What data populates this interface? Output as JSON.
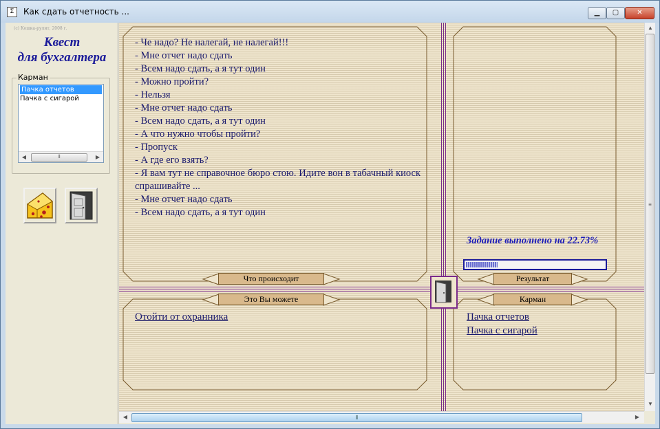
{
  "window": {
    "title": "Как сдать отчетность ...",
    "title_icon": "document-icon",
    "buttons": {
      "minimize": "▁",
      "maximize": "▢",
      "close": "✕"
    }
  },
  "left_panel": {
    "copyright": "(c) Кошка-рулит, 2008 г.",
    "title_line1": "Квест",
    "title_line2": "для бухгалтера",
    "pocket_label": "Карман",
    "pocket_items": [
      "Пачка отчетов",
      "Пачка с сигарой"
    ],
    "selected_item": "Пачка отчетов",
    "tools": [
      {
        "name": "cheese-icon"
      },
      {
        "name": "door-icon"
      }
    ]
  },
  "dialog": {
    "lines": [
      "- Че надо? Не налегай, не налегай!!!",
      "- Мне отчет надо сдать",
      "- Всем надо сдать, а я тут один",
      "- Можно пройти?",
      "- Нельзя",
      "- Мне отчет надо сдать",
      "- Всем надо сдать, а я тут один",
      "- А что нужно чтобы пройти?",
      "- Пропуск",
      "- А где его взять?",
      "- Я вам тут не справочное бюро стою. Идите вон в табачный киоск спрашивайте ...",
      "- Мне отчет надо сдать",
      "- Всем надо сдать, а я тут один"
    ]
  },
  "tags": {
    "what_happens": "Что происходит",
    "result": "Результат",
    "you_can": "Это Вы можете",
    "pocket": "Карман"
  },
  "actions": [
    "Отойти от охранника"
  ],
  "pocket_links": [
    "Пачка отчетов",
    "Пачка с сигарой"
  ],
  "progress": {
    "label": "Задание выполнено на 22.73%",
    "percent": 22.73
  },
  "colors": {
    "text_dark_blue": "#1a1a6e",
    "progress_blue": "#1b1bb8",
    "divider_purple": "#7a2b8a",
    "panel_border": "#7a5c2e",
    "tag_fill": "#d9b98c"
  }
}
